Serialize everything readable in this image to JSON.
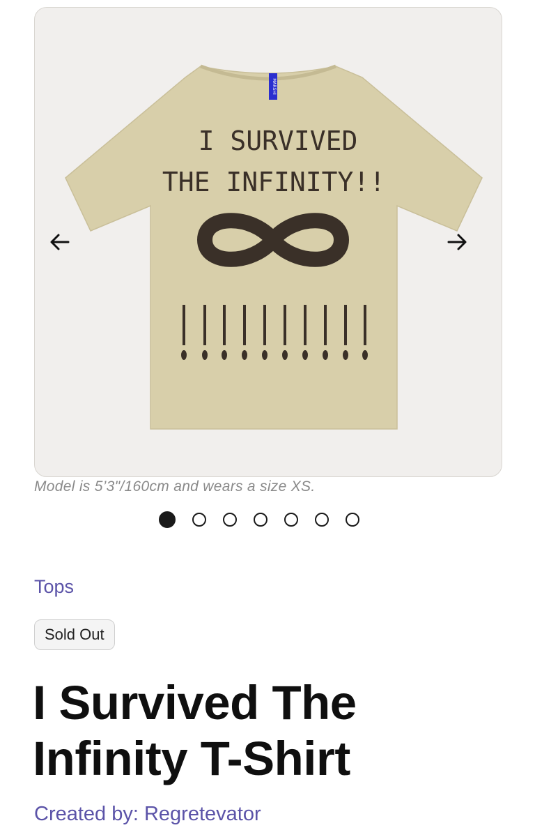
{
  "gallery": {
    "shirt_print": {
      "line1": "I SURVIVED",
      "line2": "THE INFINITY!!",
      "tag_text": "MARSHI"
    },
    "shirt_color": "#d8cfaa",
    "print_color": "#3a3028",
    "prev_icon": "arrow-left-icon",
    "next_icon": "arrow-right-icon",
    "model_note": "Model is 5’3\"/160cm and wears a size XS.",
    "slide_count": 7,
    "active_slide": 1
  },
  "product": {
    "category": "Tops",
    "status_badge": "Sold Out",
    "title": "I Survived The Infinity T-Shirt",
    "creator_line": "Created by: Regretevator"
  },
  "colors": {
    "accent": "#5b53a8",
    "title": "#0f0f0f",
    "muted": "#8a8a8a"
  }
}
